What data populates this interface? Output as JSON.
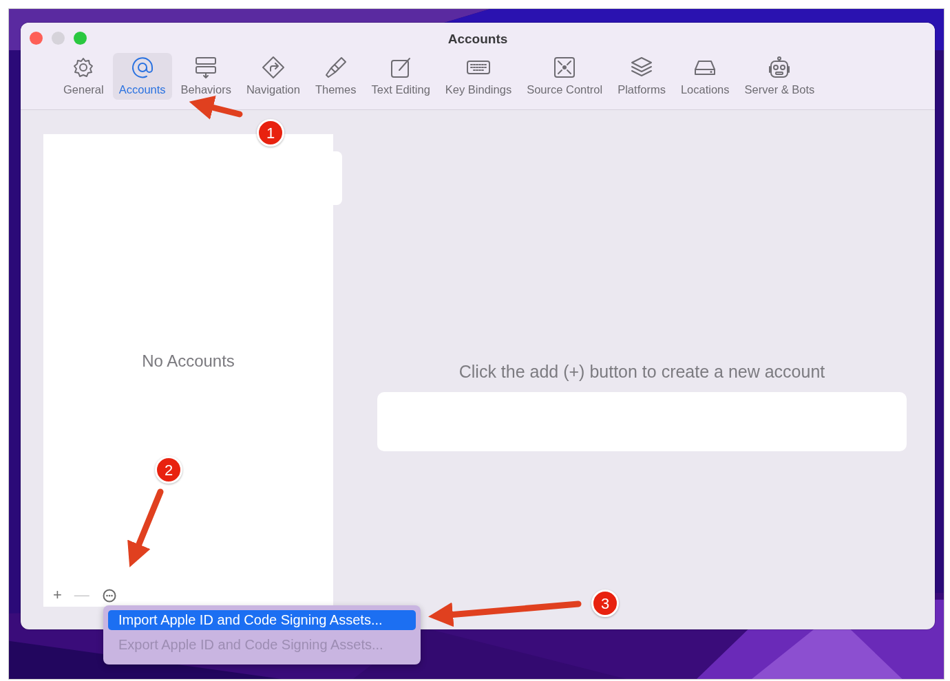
{
  "window": {
    "title": "Accounts"
  },
  "toolbar": [
    {
      "label": "General",
      "selected": false
    },
    {
      "label": "Accounts",
      "selected": true
    },
    {
      "label": "Behaviors",
      "selected": false
    },
    {
      "label": "Navigation",
      "selected": false
    },
    {
      "label": "Themes",
      "selected": false
    },
    {
      "label": "Text Editing",
      "selected": false
    },
    {
      "label": "Key Bindings",
      "selected": false
    },
    {
      "label": "Source Control",
      "selected": false
    },
    {
      "label": "Platforms",
      "selected": false
    },
    {
      "label": "Locations",
      "selected": false
    },
    {
      "label": "Server & Bots",
      "selected": false
    }
  ],
  "accounts_list": {
    "empty_text": "No Accounts",
    "buttons": [
      {
        "label": "+",
        "disabled": false
      },
      {
        "label": "—",
        "disabled": true
      }
    ]
  },
  "detail": {
    "hint": "Click the add (+) button to create a new account"
  },
  "menu": [
    {
      "label": "Import Apple ID and Code Signing Assets...",
      "selected": true,
      "disabled": false
    },
    {
      "label": "Export Apple ID and Code Signing Assets...",
      "selected": false,
      "disabled": true
    }
  ],
  "annotations": [
    {
      "number": "1"
    },
    {
      "number": "2"
    },
    {
      "number": "3"
    }
  ]
}
